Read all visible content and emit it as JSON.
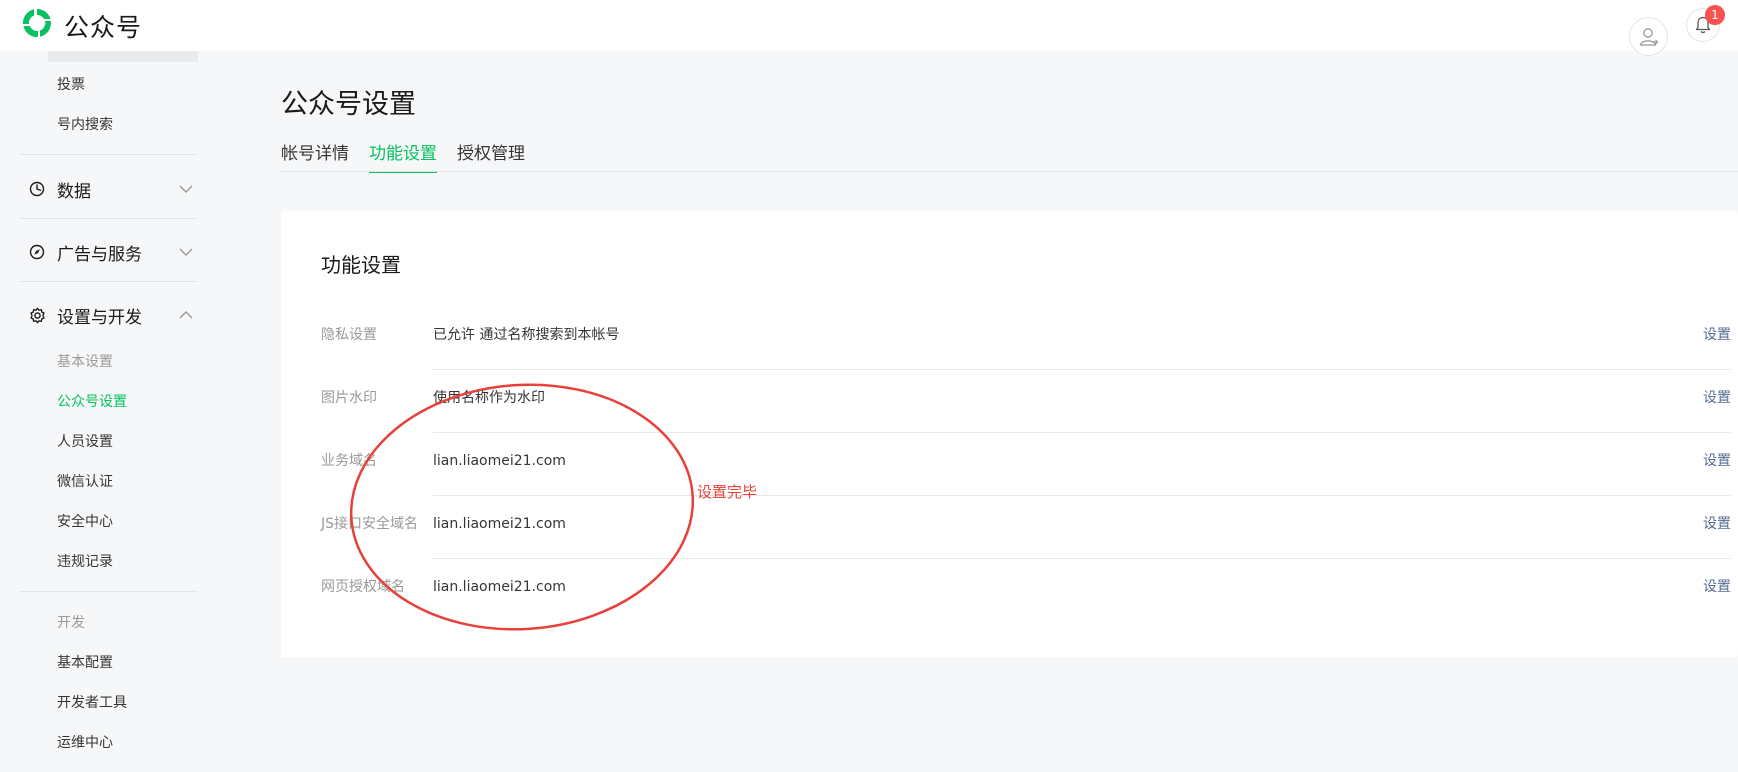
{
  "header": {
    "brand": "公众号",
    "notification_count": "1",
    "icons": {
      "logo": "wechat-official-account-logo",
      "avatar": "user-avatar-icon",
      "bell": "bell-icon"
    }
  },
  "sidebar": {
    "top_items": [
      {
        "label": "投票"
      },
      {
        "label": "号内搜索"
      }
    ],
    "groups": [
      {
        "label": "数据",
        "icon": "pie-chart-icon",
        "expanded": false
      },
      {
        "label": "广告与服务",
        "icon": "compass-icon",
        "expanded": false
      },
      {
        "label": "设置与开发",
        "icon": "gear-icon",
        "expanded": true
      }
    ],
    "settings_section": {
      "heading": "基本设置",
      "items": [
        {
          "label": "公众号设置",
          "active": true
        },
        {
          "label": "人员设置"
        },
        {
          "label": "微信认证"
        },
        {
          "label": "安全中心"
        },
        {
          "label": "违规记录"
        }
      ]
    },
    "dev_section": {
      "heading": "开发",
      "items": [
        {
          "label": "基本配置"
        },
        {
          "label": "开发者工具"
        },
        {
          "label": "运维中心"
        }
      ]
    }
  },
  "main": {
    "title": "公众号设置",
    "tabs": [
      {
        "label": "帐号详情",
        "active": false
      },
      {
        "label": "功能设置",
        "active": true
      },
      {
        "label": "授权管理",
        "active": false
      }
    ],
    "card": {
      "title": "功能设置",
      "rows": [
        {
          "label": "隐私设置",
          "value": "已允许 通过名称搜索到本帐号",
          "action": "设置"
        },
        {
          "label": "图片水印",
          "value": "使用名称作为水印",
          "action": "设置"
        },
        {
          "label": "业务域名",
          "value": "lian.liaomei21.com",
          "action": "设置"
        },
        {
          "label": "JS接口安全域名",
          "value": "lian.liaomei21.com",
          "action": "设置"
        },
        {
          "label": "网页授权域名",
          "value": "lian.liaomei21.com",
          "action": "设置"
        }
      ]
    }
  },
  "annotation": {
    "text": "设置完毕",
    "color": "#e8403a"
  },
  "colors": {
    "accent": "#07c160",
    "link": "#576b95",
    "badge": "#fa5151",
    "background": "#f6f7f9"
  }
}
